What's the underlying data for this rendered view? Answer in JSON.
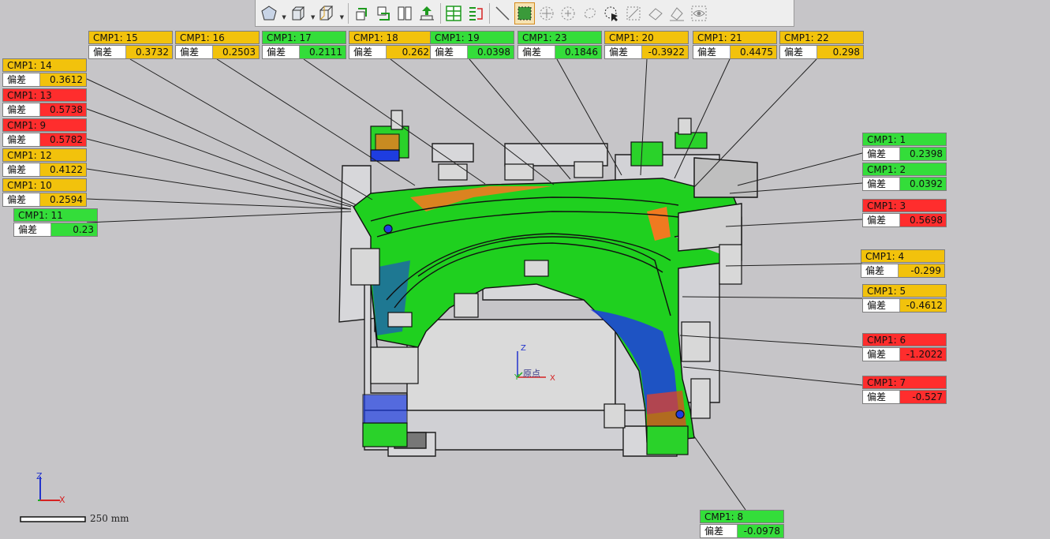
{
  "colors": {
    "background": "#c6c5c8",
    "ok": "#34dd3a",
    "warn": "#f2c20c",
    "fail": "#ff2d2d",
    "part_green": "#1fd01f",
    "part_blue": "#1e3de0",
    "part_orange": "#f07a20"
  },
  "toolbar": {
    "buttons": [
      {
        "name": "view-orientation-icon",
        "dropdown": true
      },
      {
        "name": "display-style-icon",
        "dropdown": true
      },
      {
        "name": "section-view-icon",
        "dropdown": true
      },
      {
        "name": "rotate-left-icon",
        "dropdown": false
      },
      {
        "name": "rotate-down-icon",
        "dropdown": false
      },
      {
        "name": "split-view-icon",
        "dropdown": false
      },
      {
        "name": "move-up-icon",
        "dropdown": false
      },
      {
        "name": "grid-layout-icon",
        "dropdown": false
      },
      {
        "name": "list-layout-icon",
        "dropdown": false
      },
      {
        "name": "line-select-icon",
        "dropdown": false
      },
      {
        "name": "box-select-icon",
        "dropdown": false,
        "active": true
      },
      {
        "name": "point-select-icon",
        "dropdown": false
      },
      {
        "name": "add-point-icon",
        "dropdown": false
      },
      {
        "name": "lasso-select-icon",
        "dropdown": false
      },
      {
        "name": "cursor-select-icon",
        "dropdown": false
      },
      {
        "name": "exclude-select-icon",
        "dropdown": false
      },
      {
        "name": "erase-icon",
        "dropdown": false
      },
      {
        "name": "clear-icon",
        "dropdown": false
      },
      {
        "name": "visibility-icon",
        "dropdown": false
      }
    ]
  },
  "axes": {
    "main": {
      "z": "Z",
      "x": "X"
    },
    "origin": {
      "z": "Z",
      "y": "Y",
      "x": "X",
      "label": "原点"
    }
  },
  "scale": {
    "label": "250 mm"
  },
  "deviation_label": "偏差",
  "callouts": [
    {
      "id": "CMP1: 15",
      "value": "0.3732",
      "status": "warn"
    },
    {
      "id": "CMP1: 16",
      "value": "0.2503",
      "status": "warn"
    },
    {
      "id": "CMP1: 17",
      "value": "0.2111",
      "status": "ok"
    },
    {
      "id": "CMP1: 18",
      "value": "0.262",
      "status": "warn"
    },
    {
      "id": "CMP1: 19",
      "value": "0.0398",
      "status": "ok"
    },
    {
      "id": "CMP1: 23",
      "value": "0.1846",
      "status": "ok"
    },
    {
      "id": "CMP1: 20",
      "value": "-0.3922",
      "status": "warn"
    },
    {
      "id": "CMP1: 21",
      "value": "0.4475",
      "status": "warn"
    },
    {
      "id": "CMP1: 22",
      "value": "0.298",
      "status": "warn"
    },
    {
      "id": "CMP1: 14",
      "value": "0.3612",
      "status": "warn"
    },
    {
      "id": "CMP1: 13",
      "value": "0.5738",
      "status": "fail"
    },
    {
      "id": "CMP1: 9",
      "value": "0.5782",
      "status": "fail"
    },
    {
      "id": "CMP1: 12",
      "value": "0.4122",
      "status": "warn"
    },
    {
      "id": "CMP1: 10",
      "value": "0.2594",
      "status": "warn"
    },
    {
      "id": "CMP1: 11",
      "value": "0.23",
      "status": "ok"
    },
    {
      "id": "CMP1: 1",
      "value": "0.2398",
      "status": "ok"
    },
    {
      "id": "CMP1: 2",
      "value": "0.0392",
      "status": "ok"
    },
    {
      "id": "CMP1: 3",
      "value": "0.5698",
      "status": "fail"
    },
    {
      "id": "CMP1: 4",
      "value": "-0.299",
      "status": "warn"
    },
    {
      "id": "CMP1: 5",
      "value": "-0.4612",
      "status": "warn"
    },
    {
      "id": "CMP1: 6",
      "value": "-1.2022",
      "status": "fail"
    },
    {
      "id": "CMP1: 7",
      "value": "-0.527",
      "status": "fail"
    },
    {
      "id": "CMP1: 8",
      "value": "-0.0978",
      "status": "ok"
    }
  ]
}
